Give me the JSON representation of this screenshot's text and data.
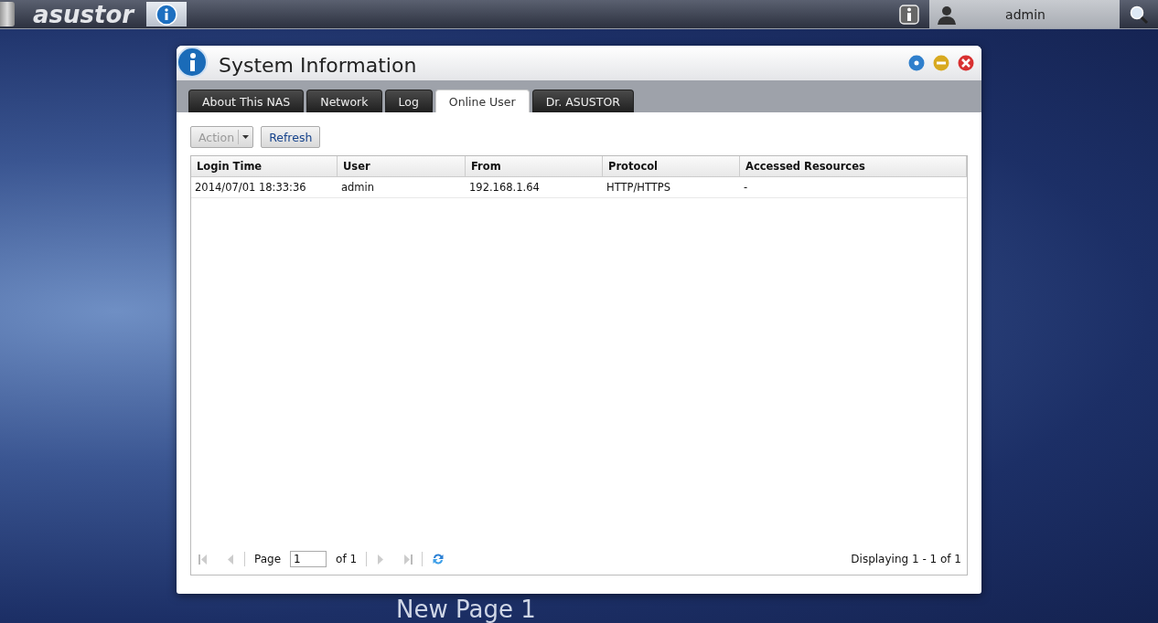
{
  "top_bar": {
    "logo": "asustor",
    "user": "admin"
  },
  "window": {
    "title": "System Information",
    "tabs": [
      {
        "label": "About This NAS",
        "selected": false
      },
      {
        "label": "Network",
        "selected": false
      },
      {
        "label": "Log",
        "selected": false
      },
      {
        "label": "Online User",
        "selected": true
      },
      {
        "label": "Dr. ASUSTOR",
        "selected": false
      }
    ],
    "toolbar": {
      "action": {
        "label": "Action",
        "disabled": true
      },
      "refresh": {
        "label": "Refresh",
        "disabled": false
      }
    },
    "table": {
      "columns": [
        "Login Time",
        "User",
        "From",
        "Protocol",
        "Accessed Resources"
      ],
      "rows": [
        [
          "2014/07/01 18:33:36",
          "admin",
          "192.168.1.64",
          "HTTP/HTTPS",
          "-"
        ]
      ]
    },
    "pager": {
      "page_label": "Page",
      "page": "1",
      "of": "of 1",
      "status": "Displaying 1 - 1 of 1"
    }
  },
  "desktop_label": "New Page 1"
}
